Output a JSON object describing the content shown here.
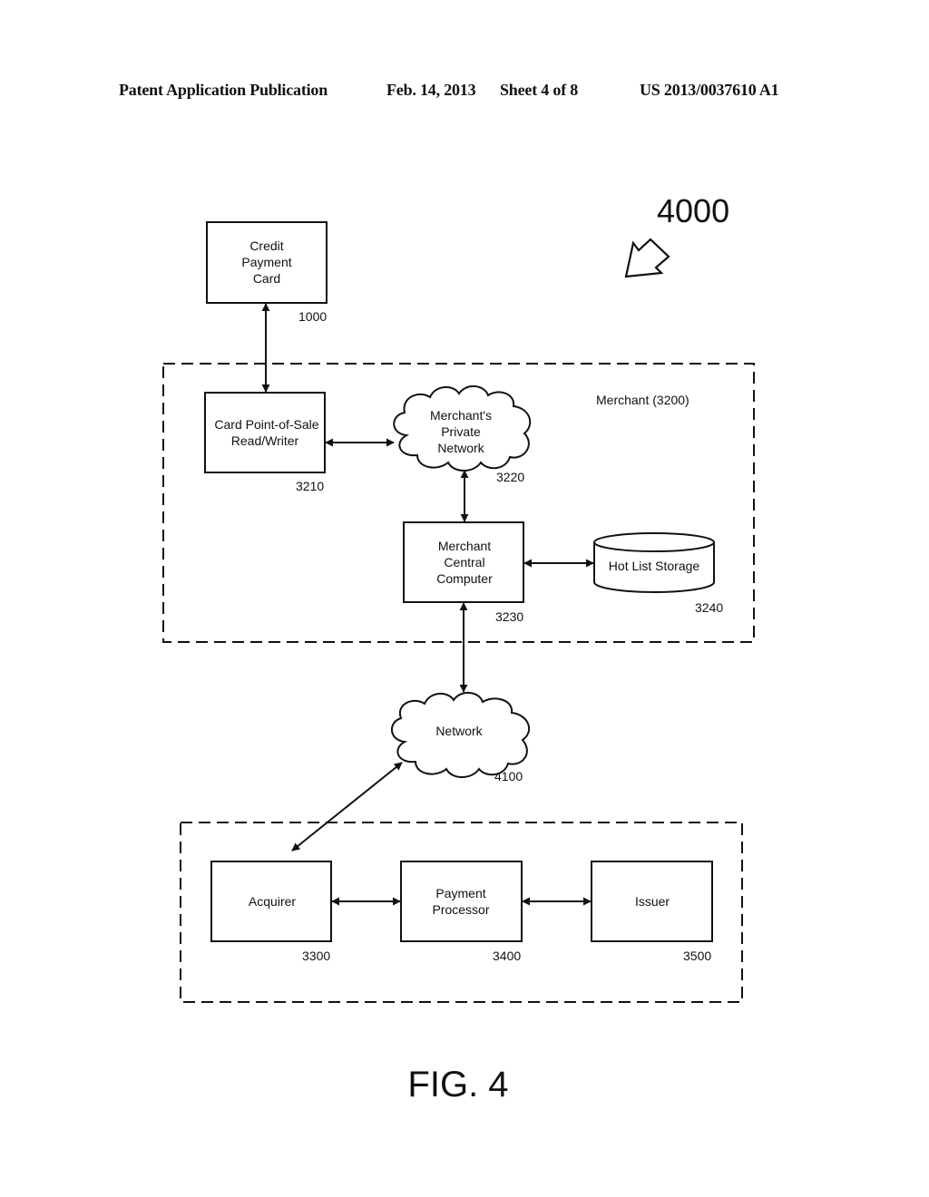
{
  "header": {
    "publication_type": "Patent Application Publication",
    "date": "Feb. 14, 2013",
    "sheet": "Sheet 4 of 8",
    "pub_number": "US 2013/0037610 A1"
  },
  "figure": {
    "ref_number": "4000",
    "caption": "FIG. 4"
  },
  "groups": {
    "merchant": {
      "label": "Merchant (3200)"
    }
  },
  "nodes": {
    "credit_card": {
      "lines": [
        "Credit",
        "Payment",
        "Card"
      ],
      "ref": "1000"
    },
    "pos_reader": {
      "lines": [
        "Card Point-of-Sale",
        "Read/Writer"
      ],
      "ref": "3210"
    },
    "private_network": {
      "lines": [
        "Merchant's",
        "Private",
        "Network"
      ],
      "ref": "3220"
    },
    "central_computer": {
      "lines": [
        "Merchant",
        "Central",
        "Computer"
      ],
      "ref": "3230"
    },
    "hot_list": {
      "lines": [
        "Hot List Storage"
      ],
      "ref": "3240"
    },
    "network": {
      "lines": [
        "Network"
      ],
      "ref": "4100"
    },
    "acquirer": {
      "lines": [
        "Acquirer"
      ],
      "ref": "3300"
    },
    "payment_processor": {
      "lines": [
        "Payment",
        "Processor"
      ],
      "ref": "3400"
    },
    "issuer": {
      "lines": [
        "Issuer"
      ],
      "ref": "3500"
    }
  },
  "edges": [
    {
      "from": "credit_card",
      "to": "pos_reader",
      "direction": "bidirectional"
    },
    {
      "from": "pos_reader",
      "to": "private_network",
      "direction": "bidirectional"
    },
    {
      "from": "private_network",
      "to": "central_computer",
      "direction": "bidirectional"
    },
    {
      "from": "central_computer",
      "to": "hot_list",
      "direction": "bidirectional"
    },
    {
      "from": "central_computer",
      "to": "network",
      "direction": "bidirectional"
    },
    {
      "from": "network",
      "to": "acquirer",
      "direction": "bidirectional"
    },
    {
      "from": "acquirer",
      "to": "payment_processor",
      "direction": "bidirectional"
    },
    {
      "from": "payment_processor",
      "to": "issuer",
      "direction": "bidirectional"
    }
  ]
}
